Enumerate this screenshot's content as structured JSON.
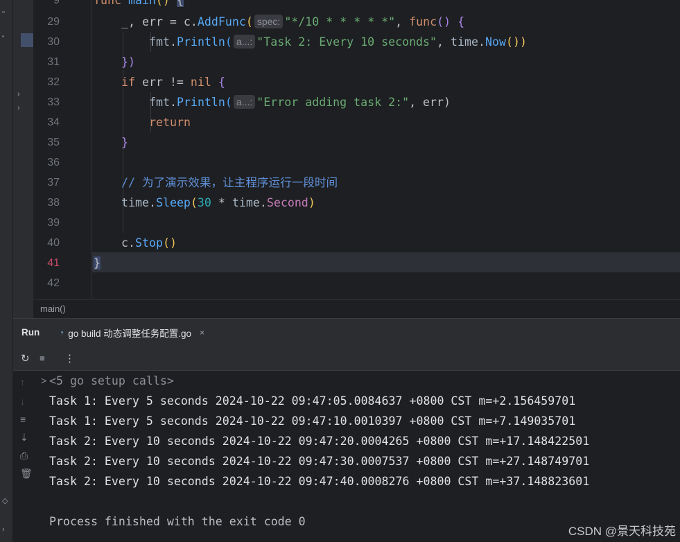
{
  "editor": {
    "partial_top_line": {
      "number": "9",
      "text": "func main() {"
    },
    "line_numbers": [
      "29",
      "30",
      "31",
      "32",
      "33",
      "34",
      "35",
      "36",
      "37",
      "38",
      "39",
      "40",
      "41",
      "42"
    ],
    "current_line": "41",
    "code": {
      "l29": {
        "a": "_, err = c.",
        "fn": "AddFunc",
        "open": "(",
        "hint": "spec:",
        "str": "\"*/10 * * * * *\"",
        "comma": ", ",
        "kw": "func",
        "tail": "() {"
      },
      "l30": {
        "pkg": "fmt",
        "dot": ".",
        "fn": "Println",
        "open": "(",
        "hint": "a...:",
        "str": "\"Task 2: Every 10 seconds\"",
        "comma": ", ",
        "pkg2": "time",
        "dot2": ".",
        "fn2": "Now",
        "close": "())"
      },
      "l31": {
        "text": "})"
      },
      "l32": {
        "kw": "if",
        "mid": " err != ",
        "kw2": "nil",
        "tail": " {"
      },
      "l33": {
        "pkg": "fmt",
        "dot": ".",
        "fn": "Println",
        "open": "(",
        "hint": "a...:",
        "str": "\"Error adding task 2:\"",
        "tail": ", err)"
      },
      "l34": {
        "kw": "return"
      },
      "l35": {
        "text": "}"
      },
      "l37": {
        "comment": "// 为了演示效果，让主程序运行一段时间"
      },
      "l38": {
        "pkg": "time",
        "dot": ".",
        "fn": "Sleep",
        "open": "(",
        "num": "30",
        "mid": " * ",
        "pkg2": "time",
        "dot2": ".",
        "prop": "Second",
        "close": ")"
      },
      "l40": {
        "a": "c.",
        "fn": "Stop",
        "tail": "()"
      },
      "l41": {
        "text": "}"
      }
    },
    "breadcrumb": "main()"
  },
  "run_window": {
    "title": "Run",
    "tab_label": "go build 动态调整任务配置.go",
    "tab_close": "×",
    "toolbar": {
      "rerun": "↻",
      "stop": "■",
      "more": "⋮"
    },
    "console": {
      "fold_chevron": ">",
      "setup_line": "<5 go setup calls>",
      "output": [
        "Task 1: Every 5 seconds 2024-10-22 09:47:05.0084637 +0800 CST m=+2.156459701",
        "Task 1: Every 5 seconds 2024-10-22 09:47:10.0010397 +0800 CST m=+7.149035701",
        "Task 2: Every 10 seconds 2024-10-22 09:47:20.0004265 +0800 CST m=+17.148422501",
        "Task 2: Every 10 seconds 2024-10-22 09:47:30.0007537 +0800 CST m=+27.148749701",
        "Task 2: Every 10 seconds 2024-10-22 09:47:40.0008276 +0800 CST m=+37.148823601"
      ],
      "exit_message": "Process finished with the exit code 0"
    }
  },
  "watermark": "CSDN @景天科技苑"
}
